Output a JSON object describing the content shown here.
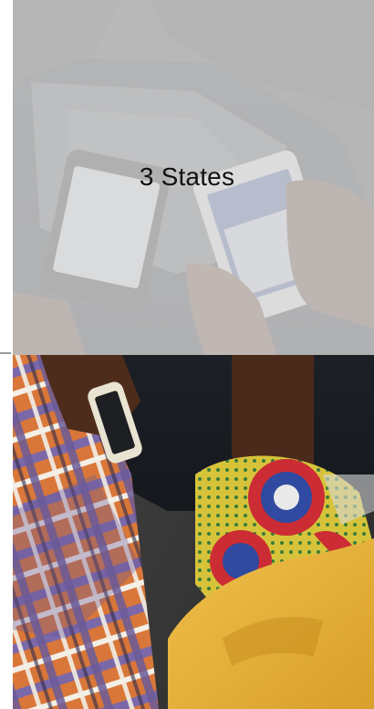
{
  "hero": {
    "title": "3 States",
    "image_subject": "people-holding-smartphones-photo"
  },
  "colors": {
    "overlay": "#d6d6d6",
    "title_text": "#111111",
    "plaid_orange": "#d9773a",
    "plaid_purple": "#7b68a8",
    "fabric_yellow": "#e2b13a",
    "fabric_red": "#cc2c33",
    "fabric_blue": "#2f4aa0",
    "skin": "#5b3522",
    "dark_bag": "#1f2329"
  }
}
